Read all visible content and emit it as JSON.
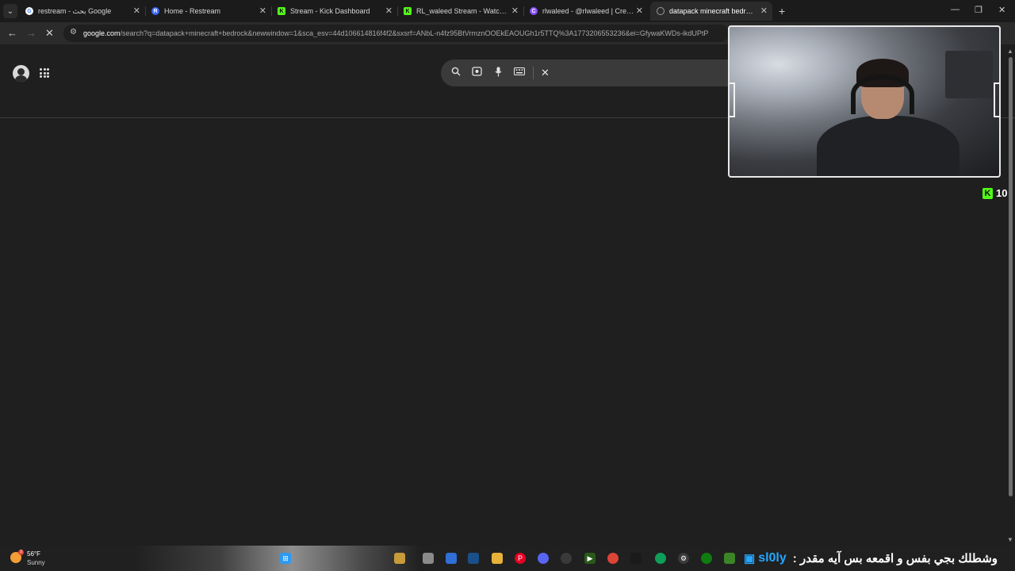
{
  "tabs": [
    {
      "title": "restream - بحث Google",
      "favicon": "google-icon",
      "color": "#ffffff",
      "active": false
    },
    {
      "title": "Home - Restream",
      "favicon": "restream-icon",
      "color": "#3a66ff",
      "active": false
    },
    {
      "title": "Stream - Kick Dashboard",
      "favicon": "kick-icon",
      "color": "#53fc18",
      "active": false
    },
    {
      "title": "RL_waleed Stream - Watch Live",
      "favicon": "kick-icon",
      "color": "#53fc18",
      "active": false
    },
    {
      "title": "rlwaleed - @rlwaleed | Creators",
      "favicon": "creators-icon",
      "color": "#8a4dff",
      "active": false
    },
    {
      "title": "datapack minecraft bedrock - ...",
      "favicon": "loading-icon",
      "color": "#9a9a9a",
      "active": true
    }
  ],
  "url": {
    "host": "google.com",
    "rest": "/search?q=datapack+minecraft+bedrock&newwindow=1&sca_esv=44d106614816f4f2&sxsrf=ANbL-n4fz95BtVrmznOOEkEAOUGh1r5TTQ%3A1773206553236&ei=GfywaKWDs-ikdUPtP"
  },
  "search": {
    "value": "",
    "placeholder": ""
  },
  "overlay": {
    "viewer_count": "10"
  },
  "taskbar": {
    "weather_temp": "56°F",
    "weather_condition": "Sunny",
    "weather_badge": "3",
    "ticker_user": "sl0ly",
    "ticker_message": ": وشطلك بجي بفس و اقمعه بس آيه مقدر"
  },
  "colors": {
    "kick_green": "#53fc18",
    "ticker_blue": "#25a6ff",
    "page_bg": "#1f1f1f"
  }
}
